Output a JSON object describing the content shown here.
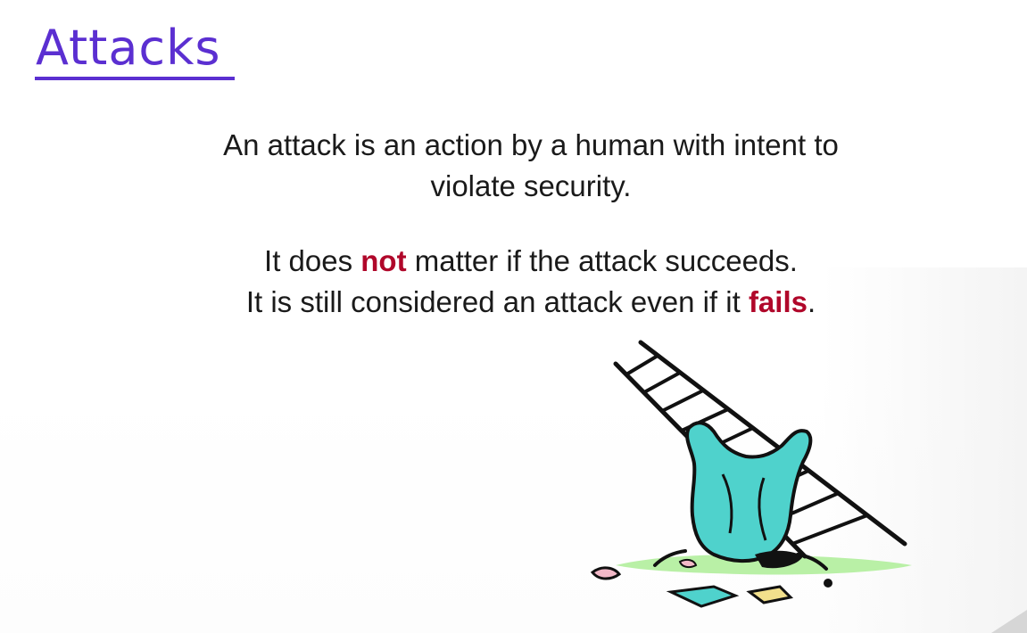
{
  "slide": {
    "title": "Attacks",
    "definition_line_1": "An attack is an action by a human with intent to",
    "definition_line_2": "violate security.",
    "note_line_1_part_1": "It does ",
    "note_line_1_highlight": "not",
    "note_line_1_part_2": " matter if the attack succeeds.",
    "note_line_2_part_1": "It is still considered an attack even if it ",
    "note_line_2_highlight": "fails",
    "note_line_2_part_2": "."
  },
  "illustration": {
    "icon": "fallen-climber-ladder-icon"
  },
  "colors": {
    "title": "#5b2fd1",
    "highlight": "#b0072a",
    "body_text": "#1a1a1a",
    "figure_fill": "#4fd2cc",
    "ground": "#b9f0a6"
  }
}
